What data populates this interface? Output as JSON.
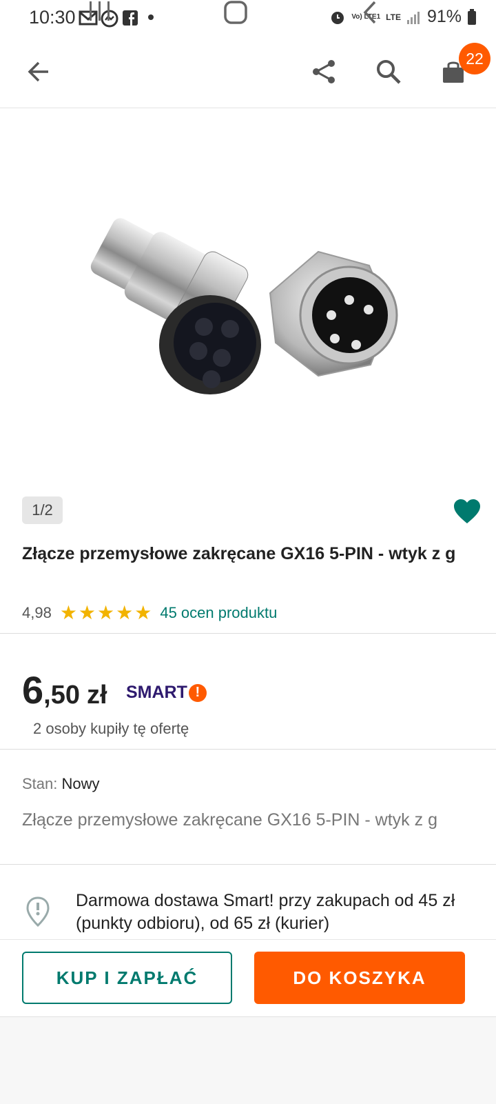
{
  "status_bar": {
    "time": "10:30",
    "battery": "91%",
    "network": "LTE",
    "volte": "Vo) LTE1",
    "icons": [
      "mail-icon",
      "messenger-icon",
      "facebook-icon",
      "dot-icon",
      "alarm-icon",
      "signal-icon",
      "battery-icon"
    ]
  },
  "app_bar": {
    "icons": [
      "back-arrow-icon",
      "share-icon",
      "search-icon",
      "cart-icon"
    ],
    "cart_count": "22"
  },
  "gallery": {
    "counter": "1/2"
  },
  "product": {
    "title": "Złącze przemysłowe zakręcane GX16 5-PIN - wtyk z g",
    "rating_value": "4,98",
    "stars": 5,
    "rating_link": "45 ocen produktu",
    "price_main": "6",
    "price_cents": ",50",
    "currency": "zł",
    "smart_label": "SMART",
    "smart_bang": "!",
    "buyers": "2 osoby kupiły tę ofertę",
    "condition_label": "Stan:",
    "condition_value": "Nowy",
    "subtitle": "Złącze przemysłowe zakręcane GX16 5-PIN - wtyk z g",
    "delivery": "Darmowa dostawa Smart! przy zakupach od 45 zł (punkty odbioru), od 65 zł (kurier)"
  },
  "actions": {
    "buy_label": "KUP I ZAPŁAĆ",
    "cart_label": "DO KOSZYKA"
  },
  "colors": {
    "brand_orange": "#ff5a00",
    "accent_teal": "#007a6e",
    "star": "#f2b300"
  }
}
